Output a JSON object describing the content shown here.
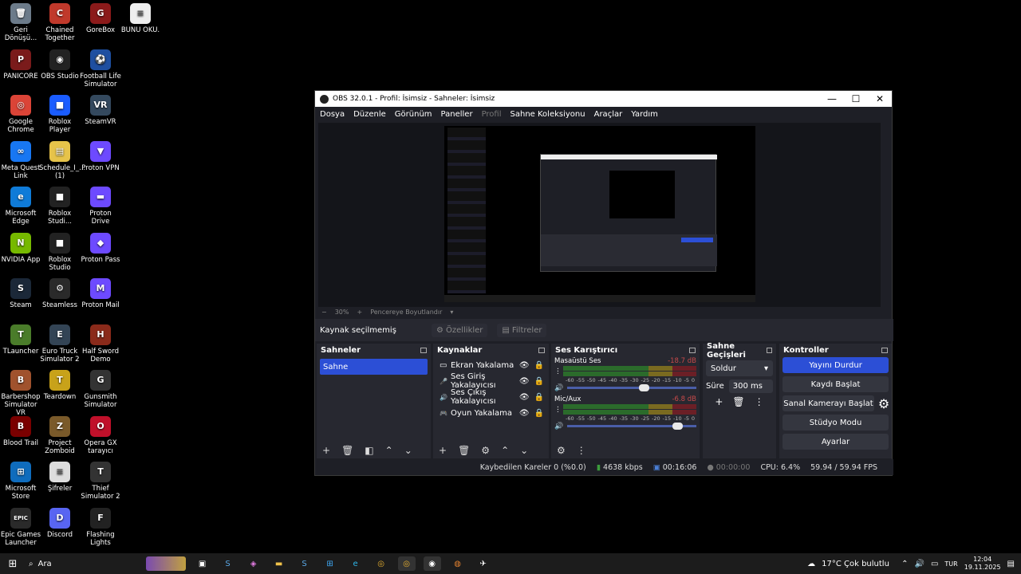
{
  "desktop_icons": [
    {
      "label": "Geri Dönüşü...",
      "color": "#6c7b8a",
      "glyph": "🗑"
    },
    {
      "label": "Chained Together",
      "color": "#c0392b",
      "glyph": "C"
    },
    {
      "label": "GoreBox",
      "color": "#8b1a1a",
      "glyph": "G"
    },
    {
      "label": "BUNU OKU.",
      "color": "#eee",
      "glyph": "≡"
    },
    {
      "label": "PANICORE",
      "color": "#7a1b1b",
      "glyph": "P"
    },
    {
      "label": "OBS Studio",
      "color": "#222",
      "glyph": "◉"
    },
    {
      "label": "Football Life Simulator",
      "color": "#1e4fa0",
      "glyph": "⚽"
    },
    {
      "label": "Google Chrome",
      "color": "#db4437",
      "glyph": "◎"
    },
    {
      "label": "Roblox Player",
      "color": "#1a5cff",
      "glyph": "■"
    },
    {
      "label": "SteamVR",
      "color": "#34495e",
      "glyph": "VR"
    },
    {
      "label": "Meta Quest Link",
      "color": "#1877f2",
      "glyph": "∞"
    },
    {
      "label": "Schedule_I_... (1)",
      "color": "#e6c34a",
      "glyph": "▤"
    },
    {
      "label": "Proton VPN",
      "color": "#6d4aff",
      "glyph": "▼"
    },
    {
      "label": "Microsoft Edge",
      "color": "#0f7bd8",
      "glyph": "e"
    },
    {
      "label": "Roblox Studi...",
      "color": "#222",
      "glyph": "■"
    },
    {
      "label": "Proton Drive",
      "color": "#6d4aff",
      "glyph": "▬"
    },
    {
      "label": "NVIDIA App",
      "color": "#76b900",
      "glyph": "N"
    },
    {
      "label": "Roblox Studio",
      "color": "#222",
      "glyph": "■"
    },
    {
      "label": "Proton Pass",
      "color": "#6d4aff",
      "glyph": "◆"
    },
    {
      "label": "Steam",
      "color": "#1b2838",
      "glyph": "S"
    },
    {
      "label": "Steamless",
      "color": "#2a2a2a",
      "glyph": "⚙"
    },
    {
      "label": "Proton Mail",
      "color": "#6d4aff",
      "glyph": "M"
    },
    {
      "label": "TLauncher",
      "color": "#4a7c2a",
      "glyph": "T"
    },
    {
      "label": "Euro Truck Simulator 2",
      "color": "#345",
      "glyph": "E"
    },
    {
      "label": "Half Sword Demo",
      "color": "#8a2a1a",
      "glyph": "H"
    },
    {
      "label": "Barbershop Simulator VR",
      "color": "#a0522d",
      "glyph": "B"
    },
    {
      "label": "Teardown",
      "color": "#c8a21a",
      "glyph": "T"
    },
    {
      "label": "Gunsmith Simulator",
      "color": "#333",
      "glyph": "G"
    },
    {
      "label": "Blood Trail",
      "color": "#7a0000",
      "glyph": "B"
    },
    {
      "label": "Project Zomboid",
      "color": "#7a5a2a",
      "glyph": "Z"
    },
    {
      "label": "Opera GX tarayıcı",
      "color": "#c0102a",
      "glyph": "O"
    },
    {
      "label": "Microsoft Store",
      "color": "#0f6cbd",
      "glyph": "⊞"
    },
    {
      "label": "Şifreler",
      "color": "#ddd",
      "glyph": "≡"
    },
    {
      "label": "Thief Simulator 2",
      "color": "#333",
      "glyph": "T"
    },
    {
      "label": "Epic Games Launcher",
      "color": "#2a2a2a",
      "glyph": "EPIC"
    },
    {
      "label": "Discord",
      "color": "#5865f2",
      "glyph": "D"
    },
    {
      "label": "Flashing Lights",
      "color": "#222",
      "glyph": "F"
    }
  ],
  "window": {
    "title": "OBS 32.0.1 - Profil: İsimsiz - Sahneler: İsimsiz",
    "minimize": "—",
    "maximize": "☐",
    "close": "✕"
  },
  "menu": [
    "Dosya",
    "Düzenle",
    "Görünüm",
    "Paneller",
    "Profil",
    "Sahne Koleksiyonu",
    "Araçlar",
    "Yardım"
  ],
  "preview": {
    "zoom": "30%",
    "minus": "−",
    "plus": "+",
    "fit_label": "Pencereye Boyutlandır"
  },
  "source_toolbar": {
    "no_source": "Kaynak seçilmemiş",
    "properties": "Özellikler",
    "filters": "Filtreler"
  },
  "scenes": {
    "title": "Sahneler",
    "items": [
      "Sahne"
    ]
  },
  "sources": {
    "title": "Kaynaklar",
    "items": [
      {
        "icon": "▭",
        "label": "Ekran Yakalama"
      },
      {
        "icon": "🎤",
        "label": "Ses Giriş Yakalayıcısı"
      },
      {
        "icon": "🔊",
        "label": "Ses Çıkış Yakalayıcısı"
      },
      {
        "icon": "🎮",
        "label": "Oyun Yakalama"
      }
    ]
  },
  "mixer": {
    "title": "Ses Karıştırıcı",
    "channels": [
      {
        "name": "Masaüstü Ses",
        "db": "-18.7 dB",
        "level": 0.66,
        "volume": 0.59
      },
      {
        "name": "Mic/Aux",
        "db": "-6.8 dB",
        "level": 0.4,
        "volume": 0.85
      }
    ],
    "scale": [
      "-60",
      "-55",
      "-50",
      "-45",
      "-40",
      "-35",
      "-30",
      "-25",
      "-20",
      "-15",
      "-10",
      "-5",
      "0"
    ]
  },
  "transitions": {
    "title": "Sahne Geçişleri",
    "selected": "Soldur",
    "duration_label": "Süre",
    "duration": "300 ms"
  },
  "controls": {
    "title": "Kontroller",
    "stop_stream": "Yayını Durdur",
    "start_record": "Kaydı Başlat",
    "virtual_cam": "Sanal Kamerayı Başlat",
    "studio_mode": "Stüdyo Modu",
    "settings": "Ayarlar"
  },
  "status": {
    "dropped": "Kaybedilen Kareler 0 (%0.0)",
    "bitrate": "4638 kbps",
    "stream_time": "00:16:06",
    "rec_time": "00:00:00",
    "cpu": "CPU: 6.4%",
    "fps": "59.94 / 59.94 FPS"
  },
  "taskbar": {
    "search": "Ara",
    "weather": "17°C  Çok bulutlu",
    "lang": "TUR",
    "time": "12:04",
    "date": "19.11.2025"
  },
  "colors": {
    "accent": "#2c4fd6",
    "panel": "#272830",
    "window": "#1e1f26"
  }
}
